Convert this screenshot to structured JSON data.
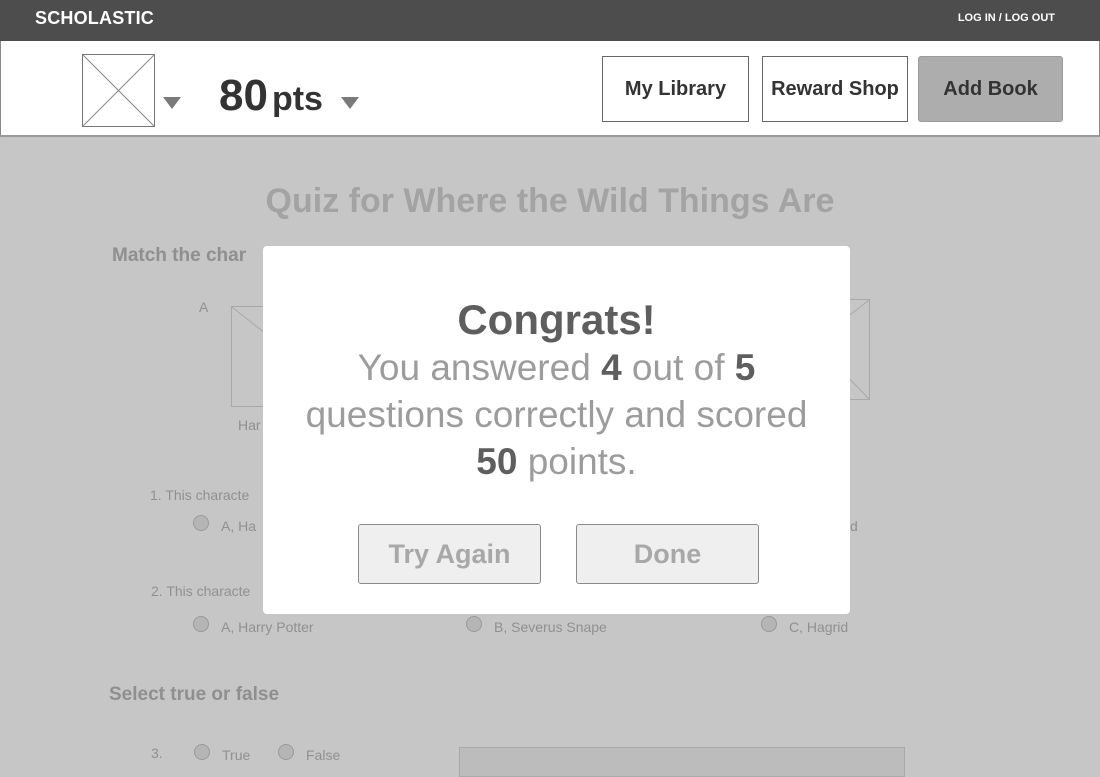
{
  "topbar": {
    "brand": "SCHOLASTIC",
    "login": "LOG IN / LOG OUT"
  },
  "header": {
    "points_value": "80",
    "points_unit": "pts",
    "buttons": {
      "library": "My Library",
      "shop": "Reward Shop",
      "add": "Add Book"
    }
  },
  "quiz": {
    "title": "Quiz for Where the Wild Things Are",
    "match_section": "Match the char",
    "label_a": "A",
    "char_name_partial": "Har",
    "q1_partial": "1. This characte",
    "q1_option_a_partial": "A, Ha",
    "q1_option_c_partial": "d",
    "q2_partial": "2. This characte",
    "q2_options": [
      "A, Harry Potter",
      "B, Severus Snape",
      "C, Hagrid"
    ],
    "tf_section": "Select true or false",
    "q3_number": "3.",
    "q3_options": [
      "True",
      "False"
    ]
  },
  "modal": {
    "heading": "Congrats!",
    "msg_prefix": "You answered",
    "correct": "4",
    "msg_mid": "out of",
    "total": "5",
    "msg_line2": "questions correctly and scored",
    "points": "50",
    "points_word": "points.",
    "try_again": "Try Again",
    "done": "Done"
  }
}
